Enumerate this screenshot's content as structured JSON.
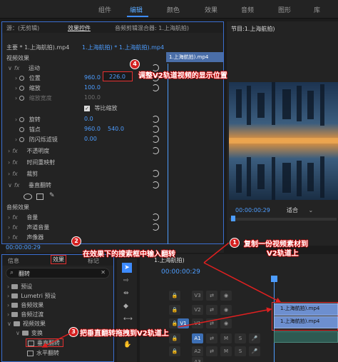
{
  "workspace_tabs": [
    "组件",
    "编辑",
    "颜色",
    "效果",
    "音频",
    "图形",
    "库"
  ],
  "source_panel": {
    "tabs": [
      "源：(无剪辑)",
      "效果控件",
      "音频剪辑混合器: 1.上海航拍)"
    ],
    "clip_path": "主要 * 1.上海航拍).mp4",
    "seq_path": "1.上海航拍) * 1.上海航拍).mp4",
    "ruler_clip": "1.上海航拍).mp4",
    "video_effects_label": "视频效果",
    "motion_label": "运动",
    "position_label": "位置",
    "position_x": "960.0",
    "position_y": "226.0",
    "scale_label": "缩放",
    "scale_value": "100.0",
    "scale_width_label": "缩放宽度",
    "scale_width_value": "100.0",
    "uniform_scale_label": "等比缩放",
    "rotation_label": "旋转",
    "rotation_value": "0.0",
    "anchor_label": "锚点",
    "anchor_x": "960.0",
    "anchor_y": "540.0",
    "antiflicker_label": "防闪烁滤镜",
    "antiflicker_value": "0.00",
    "opacity_label": "不透明度",
    "time_remap_label": "时间重映射",
    "crop_label": "裁剪",
    "vflip_label": "垂直翻转",
    "audio_effects_label": "音频效果",
    "volume_label": "音量",
    "channel_volume_label": "声道音量",
    "panner_label": "声像器",
    "timecode": "00:00:00:29"
  },
  "program_panel": {
    "title": "节目:1.上海航拍)",
    "timecode": "00:00:00:29",
    "zoom_select": "适合"
  },
  "effects_panel": {
    "tabs": [
      "信息",
      "效果",
      "标记"
    ],
    "search_value": "翻转",
    "items": [
      {
        "label": "预设",
        "indent": 0
      },
      {
        "label": "Lumetri 预设",
        "indent": 0
      },
      {
        "label": "音频效果",
        "indent": 0
      },
      {
        "label": "音频过渡",
        "indent": 0
      },
      {
        "label": "视频效果",
        "indent": 0
      },
      {
        "label": "变换",
        "indent": 1
      },
      {
        "label": "垂直翻转",
        "indent": 2
      },
      {
        "label": "水平翻转",
        "indent": 2
      }
    ]
  },
  "timeline": {
    "title": "1.上海航拍)",
    "timecode": "00:00:00:29",
    "tracks": [
      "V3",
      "V2",
      "V1",
      "A1",
      "A2",
      "A3"
    ],
    "clip_v2": "1.上海航拍).mp4",
    "clip_v1": "1.上海航拍).mp4"
  },
  "annotations": {
    "a1_num": "1",
    "a1_line1": "复制一份视频素材到",
    "a1_line2": "V2轨道上",
    "a2_num": "2",
    "a2_text": "在效果下的搜索框中输入翻转",
    "a3_num": "3",
    "a3_text": "把垂直翻转拖拽到V2轨道上",
    "a4_num": "4",
    "a4_text": "调整V2轨道视频的显示位置"
  },
  "colors": {
    "accent": "#3d8bff",
    "annotation": "#d42020",
    "clip": "#6d8fcf"
  }
}
